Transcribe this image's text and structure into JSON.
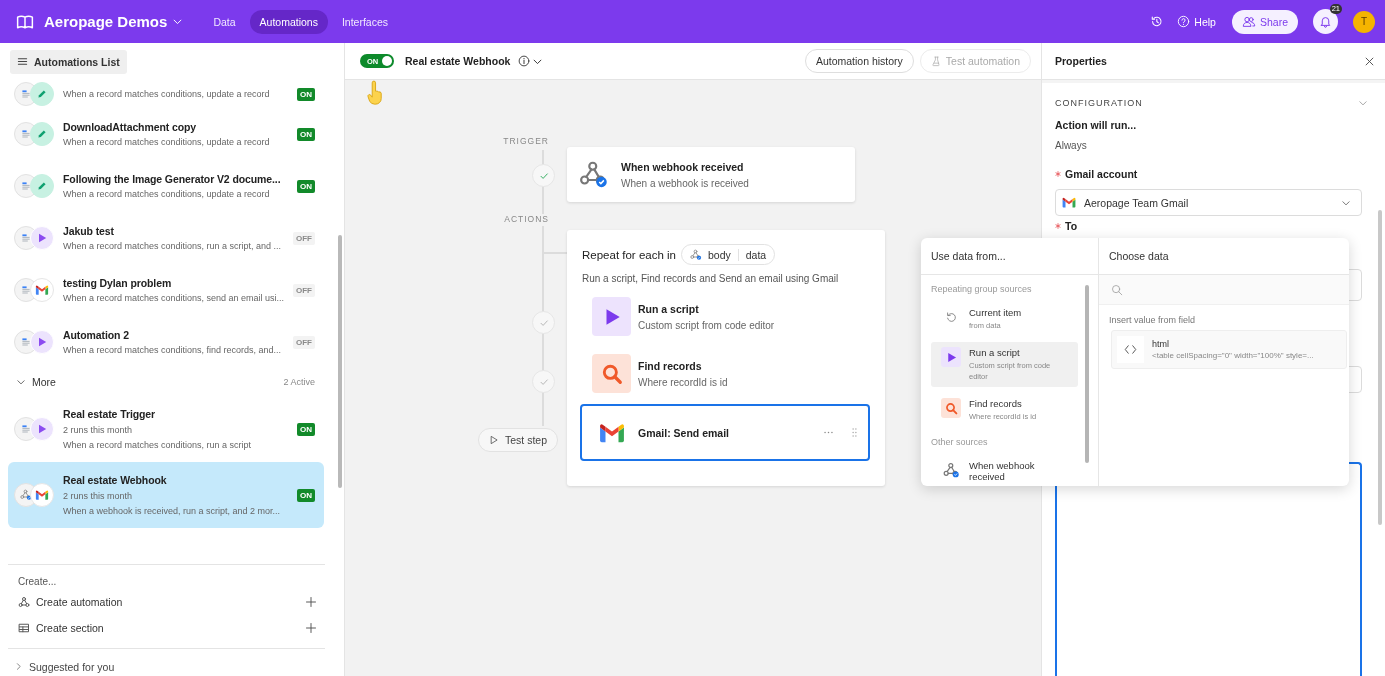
{
  "app_bar": {
    "title": "Aeropage Demos",
    "nav": [
      {
        "label": "Data",
        "selected": false
      },
      {
        "label": "Automations",
        "selected": true
      },
      {
        "label": "Interfaces",
        "selected": false
      }
    ],
    "help": "Help",
    "share": "Share",
    "notification_count": "21",
    "avatar": "T"
  },
  "sidebar": {
    "header_button": "Automations List",
    "items": [
      {
        "description": "When a record matches conditions, update a record",
        "status": "ON",
        "on": true,
        "icons": [
          {
            "kind": "record"
          },
          {
            "kind": "update"
          }
        ],
        "selected": false
      },
      {
        "name": "DownloadAttachment copy",
        "description": "When a record matches conditions, update a record",
        "status": "ON",
        "on": true,
        "icons": [
          {
            "kind": "record"
          },
          {
            "kind": "update"
          }
        ],
        "selected": false
      },
      {
        "name": "Following the Image Generator V2 docume...",
        "description": "When a record matches conditions, update a record",
        "status": "ON",
        "on": true,
        "icons": [
          {
            "kind": "record"
          },
          {
            "kind": "update"
          }
        ],
        "selected": false
      },
      {
        "name": "Jakub test",
        "description": "When a record matches conditions, run a script, and ...",
        "status": "OFF",
        "on": false,
        "icons": [
          {
            "kind": "record"
          },
          {
            "kind": "script"
          }
        ],
        "selected": false
      },
      {
        "name": "testing Dylan problem",
        "description": "When a record matches conditions, send an email usi...",
        "status": "OFF",
        "on": false,
        "icons": [
          {
            "kind": "record"
          },
          {
            "kind": "gmail"
          }
        ],
        "selected": false
      },
      {
        "name": "Automation 2",
        "description": "When a record matches conditions, find records, and...",
        "status": "OFF",
        "on": false,
        "icons": [
          {
            "kind": "record"
          },
          {
            "kind": "script"
          }
        ],
        "selected": false
      }
    ],
    "more": {
      "label": "More",
      "count": "2 Active",
      "expanded": true,
      "items": [
        {
          "name": "Real estate Trigger",
          "runs": "2 runs this month",
          "description": "When a record matches conditions, run a script",
          "status": "ON",
          "on": true,
          "icons": [
            {
              "kind": "record"
            },
            {
              "kind": "script"
            }
          ],
          "selected": false
        },
        {
          "name": "Real estate Webhook",
          "runs": "2 runs this month",
          "description": "When a webhook is received, run a script, and 2 mor...",
          "status": "ON",
          "on": true,
          "icons": [
            {
              "kind": "webhook"
            },
            {
              "kind": "gmail"
            }
          ],
          "selected": true
        }
      ]
    },
    "create": {
      "title": "Create...",
      "actions": [
        {
          "kind": "automation",
          "label": "Create automation"
        },
        {
          "kind": "section",
          "label": "Create section"
        }
      ]
    },
    "suggested": {
      "label": "Suggested for you",
      "expanded": false
    }
  },
  "automation": {
    "enabled": true,
    "toggle_label": "ON",
    "name": "Real estate Webhook",
    "history_button": "Automation history",
    "test_button": {
      "label": "Test automation",
      "disabled": true
    }
  },
  "flow": {
    "trigger_label": "TRIGGER",
    "actions_label": "ACTIONS",
    "trigger": {
      "kind": "webhook",
      "title": "When webhook received",
      "subtitle": "When a webhook is received",
      "verified": true
    },
    "repeat": {
      "title": "Repeat for each in",
      "chip": [
        "body",
        "data"
      ],
      "summary": "Run a script, Find records and Send an email using Gmail",
      "steps": [
        {
          "kind": "script",
          "title": "Run a script",
          "subtitle": "Custom script from code editor",
          "selected": false,
          "verified": false
        },
        {
          "kind": "search",
          "title": "Find records",
          "subtitle": "Where recordId is id",
          "selected": false,
          "verified": false
        },
        {
          "kind": "gmail",
          "title": "Gmail: Send email",
          "selected": true
        }
      ]
    },
    "test_step": "Test step"
  },
  "properties": {
    "title": "Properties",
    "section": "CONFIGURATION",
    "expanded": true,
    "run_label": "Action will run...",
    "run_value": "Always",
    "fields": [
      {
        "kind": "select",
        "label": "Gmail account",
        "required": true,
        "value": "Aeropage Team Gmail",
        "focused": false
      },
      {
        "kind": "input",
        "label": "To",
        "required": true,
        "focused": false
      },
      {
        "kind": "input",
        "focused": false
      },
      {
        "kind": "textarea",
        "focused": true
      }
    ]
  },
  "data_picker": {
    "sources_title": "Use data from...",
    "groups": [
      {
        "title": "Repeating group sources",
        "items": [
          {
            "kind": "loop",
            "title": "Current item",
            "subtitle": "from data",
            "selected": false
          },
          {
            "kind": "script",
            "title": "Run a script",
            "subtitle": "Custom script from code editor",
            "selected": true
          },
          {
            "kind": "search",
            "title": "Find records",
            "subtitle": "Where recordId is id",
            "selected": false
          }
        ]
      },
      {
        "title": "Other sources",
        "items": [
          {
            "kind": "webhook",
            "title": "When webhook received",
            "selected": false
          }
        ]
      }
    ],
    "choose_title": "Choose data",
    "insert_label": "Insert value from field",
    "fields": [
      {
        "name": "html",
        "preview": "<table cellSpacing=\"0\" width=\"100%\" style=..."
      }
    ]
  }
}
